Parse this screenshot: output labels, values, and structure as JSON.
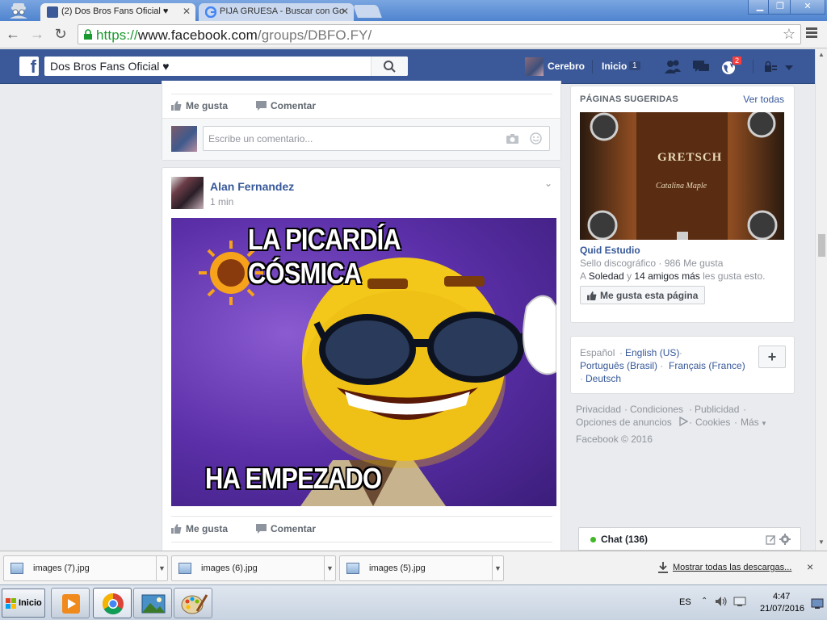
{
  "browser": {
    "tabs": [
      {
        "title": "(2) Dos Bros Fans Oficial ♥",
        "active": true
      },
      {
        "title": "PIJA GRUESA - Buscar con Go",
        "active": false
      }
    ],
    "url_scheme": "https://",
    "url_host": "www.facebook.com",
    "url_path": "/groups/DBFO.FY/"
  },
  "facebook": {
    "logo": "f",
    "search_value": "Dos Bros Fans Oficial ♥",
    "profile_name": "Cerebro",
    "home_label": "Inicio",
    "home_count": "1",
    "notifications_count": "2"
  },
  "post_prev": {
    "like_label": "Me gusta",
    "comment_label": "Comentar",
    "comment_placeholder": "Escribe un comentario..."
  },
  "post": {
    "author": "Alan Fernandez",
    "time": "1 min",
    "meme_top_text": "LA PICARDÍA CÓSMICA",
    "meme_bottom_text": "HA EMPEZADO",
    "like_label": "Me gusta",
    "comment_label": "Comentar"
  },
  "suggested": {
    "title": "PÁGINAS SUGERIDAS",
    "see_all": "Ver todas",
    "image_text_brand": "GRETSCH",
    "image_text_model": "Catalina Maple",
    "page_name": "Quid Estudio",
    "page_meta": "Sello discográfico · 986 Me gusta",
    "friends_prefix": "A ",
    "friend_1": "Soledad",
    "friends_mid": " y ",
    "friend_2": "14 amigos más",
    "friends_suffix": " les gusta esto.",
    "like_button": "Me gusta esta página"
  },
  "languages": {
    "current": "Español",
    "items": [
      "English (US)",
      "Português (Brasil)",
      "Français (France)",
      "Deutsch"
    ],
    "sep": " · ",
    "add": "+"
  },
  "footer": {
    "line1": [
      "Privacidad",
      "Condiciones",
      "Publicidad"
    ],
    "line2": [
      "Opciones de anuncios",
      "Cookies",
      "Más"
    ],
    "copyright": "Facebook © 2016"
  },
  "chat": {
    "label": "Chat (136)"
  },
  "downloads": {
    "items": [
      "images (7).jpg",
      "images (6).jpg",
      "images (5).jpg"
    ],
    "show_all": "Mostrar todas las descargas...",
    "close": "×"
  },
  "taskbar": {
    "start_label": "Inicio",
    "language": "ES",
    "time": "4:47",
    "date": "21/07/2016"
  },
  "colors": {
    "facebook_blue": "#3b5998",
    "link_blue": "#365899",
    "notification_red": "#fa3e3e",
    "online_green": "#42b72a"
  }
}
